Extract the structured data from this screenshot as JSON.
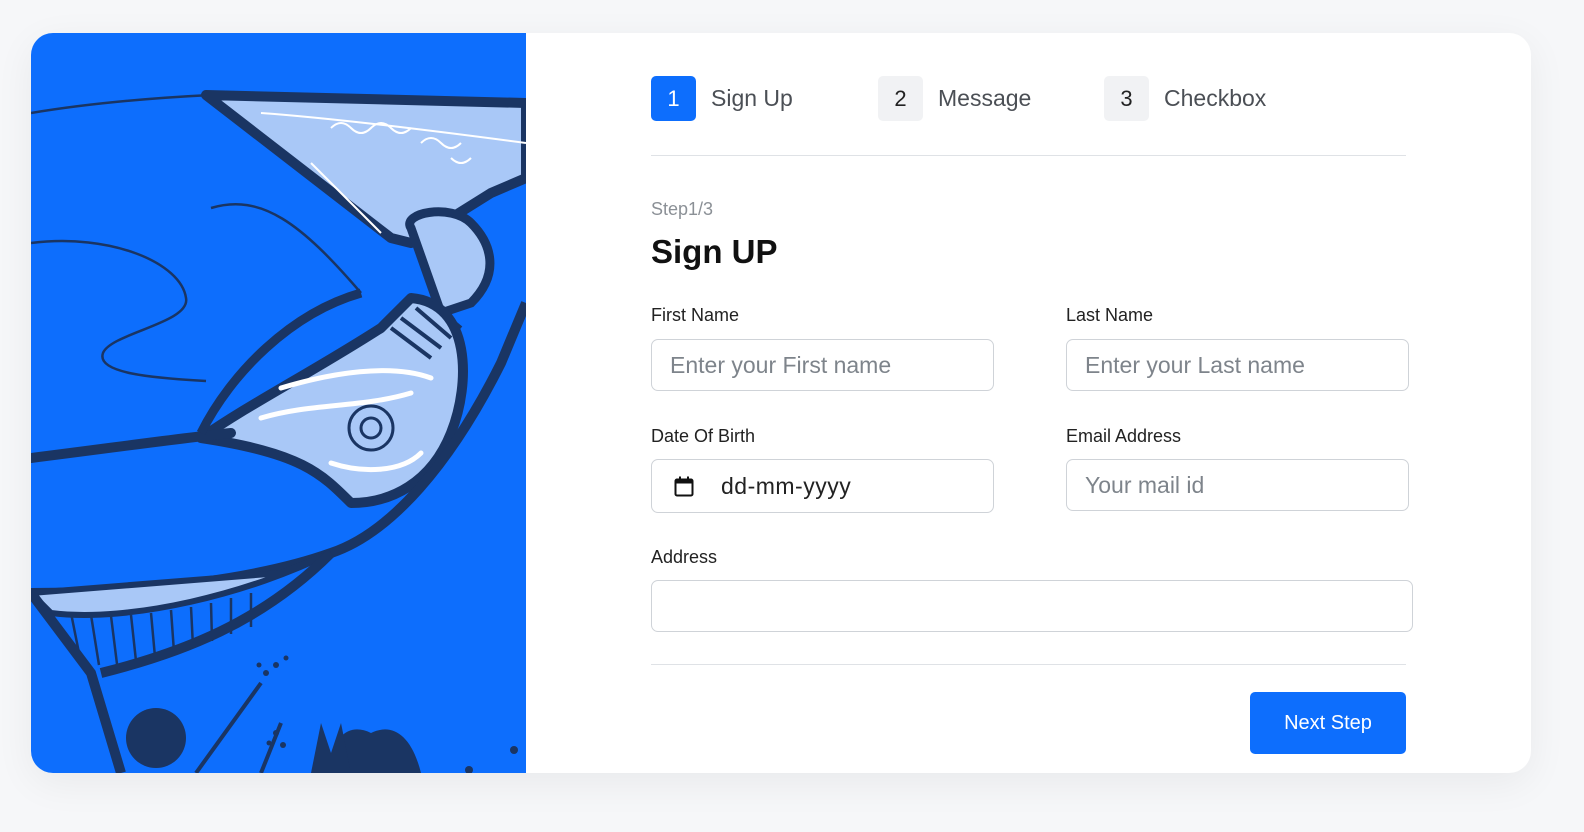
{
  "steps": [
    {
      "number": "1",
      "label": "Sign Up"
    },
    {
      "number": "2",
      "label": "Message"
    },
    {
      "number": "3",
      "label": "Checkbox"
    }
  ],
  "active_step": 1,
  "form": {
    "step_caption": "Step1/3",
    "title": "Sign UP",
    "first_name": {
      "label": "First Name",
      "placeholder": "Enter your First name",
      "value": ""
    },
    "last_name": {
      "label": "Last Name",
      "placeholder": "Enter your Last name",
      "value": ""
    },
    "dob": {
      "label": "Date Of Birth",
      "placeholder": "dd-mm-yyyy",
      "icon": "calendar-icon"
    },
    "email": {
      "label": "Email Address",
      "placeholder": "Your mail id",
      "value": ""
    },
    "address": {
      "label": "Address",
      "placeholder": "",
      "value": ""
    },
    "next_label": "Next Step"
  },
  "colors": {
    "primary": "#0d6efd",
    "illustration_dark": "#1a3563",
    "illustration_light": "#a9c8f7",
    "card_bg": "#ffffff",
    "page_bg": "#f6f7f9"
  }
}
